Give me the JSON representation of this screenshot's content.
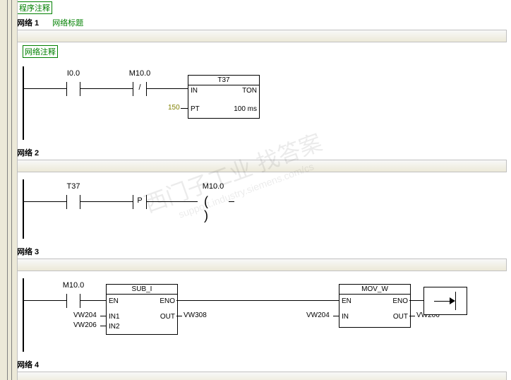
{
  "prog_comment_label": "程序注释",
  "networks": [
    {
      "label": "网络 1",
      "subtitle": "网络标题",
      "comment": "网络注释",
      "n1": {
        "contact1_label": "I0.0",
        "contact2_label": "M10.0",
        "contact2_mark": "/",
        "timer_title": "T37",
        "timer_type": "TON",
        "timer_in": "IN",
        "timer_pt": "PT",
        "timer_pt_value": "150",
        "timer_pt_time": "100 ms"
      }
    },
    {
      "label": "网络 2",
      "n2": {
        "contact1_label": "T37",
        "contact2_mark": "P",
        "coil_label": "M10.0"
      }
    },
    {
      "label": "网络 3",
      "n3": {
        "contact1_label": "M10.0",
        "sub_title": "SUB_I",
        "en": "EN",
        "eno": "ENO",
        "in1": "IN1",
        "in2": "IN2",
        "out": "OUT",
        "in1_val": "VW204",
        "in2_val": "VW206",
        "out_val": "VW308",
        "mov_title": "MOV_W",
        "mov_in": "IN",
        "mov_in_val": "VW204",
        "mov_out_val": "VW206"
      }
    },
    {
      "label": "网络 4"
    }
  ],
  "watermark": {
    "main": "西门子工业    找答案",
    "sub": "support.industry.siemens.com/cs"
  }
}
